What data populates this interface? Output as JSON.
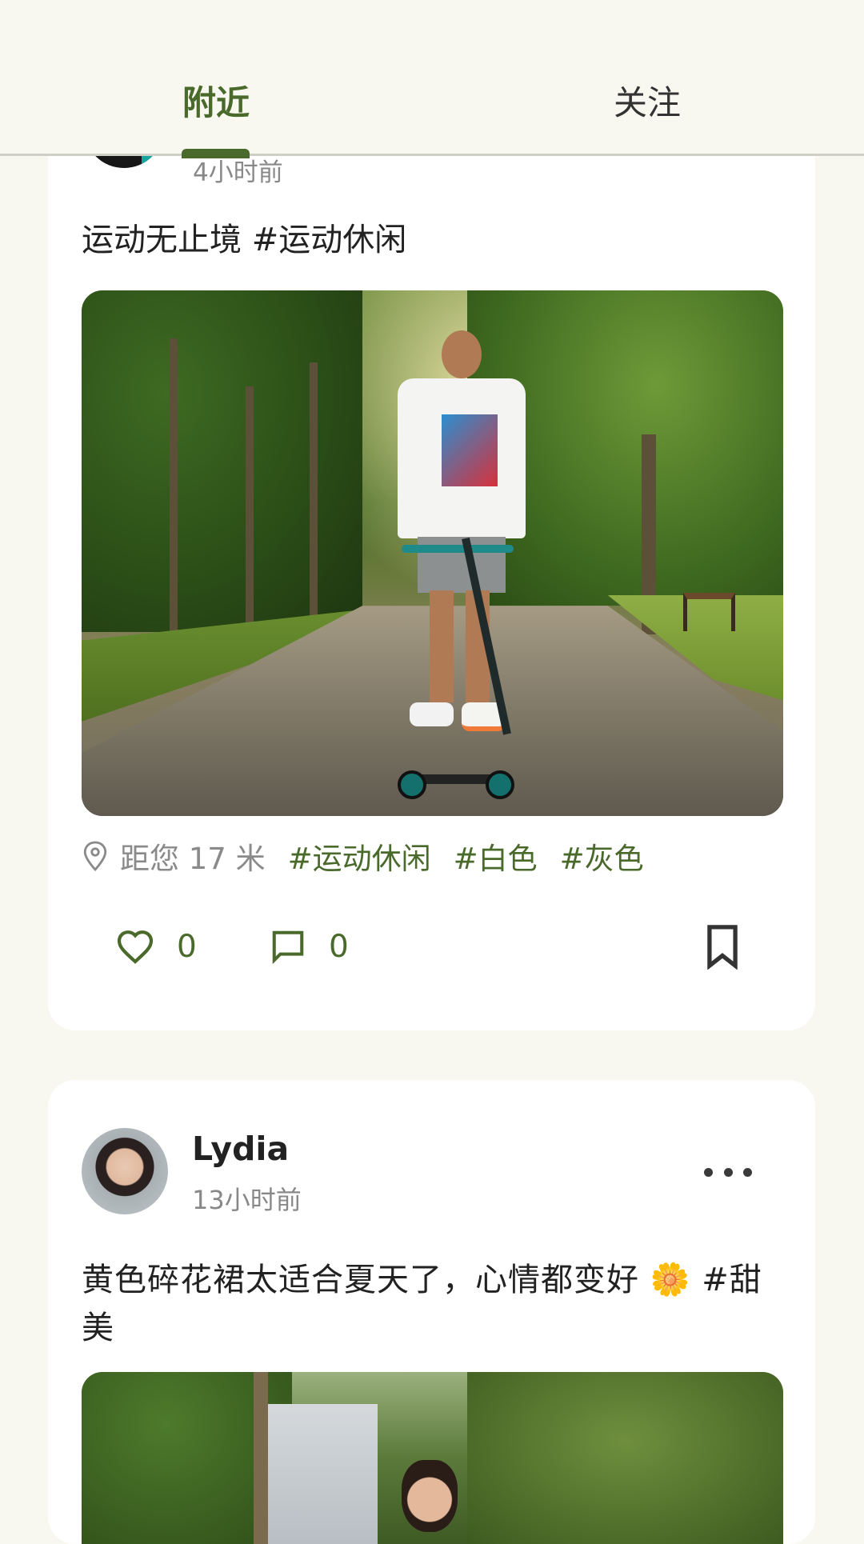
{
  "tabs": [
    {
      "label": "附近",
      "active": true
    },
    {
      "label": "关注",
      "active": false
    }
  ],
  "colors": {
    "accent": "#4a6a2c",
    "background": "#f8f8f1",
    "card": "#ffffff"
  },
  "posts": [
    {
      "time": "4小时前",
      "text": "运动无止境 #运动休闲",
      "distance": "距您 17 米",
      "tags": [
        "#运动休闲",
        "#白色",
        "#灰色"
      ],
      "likes": "0",
      "comments": "0",
      "icons": [
        "location-icon",
        "heart-icon",
        "comment-icon",
        "bookmark-icon"
      ]
    },
    {
      "author": "Lydia",
      "time": "13小时前",
      "text": "黄色碎花裙太适合夏天了，心情都变好 🌼 #甜美",
      "icons": [
        "more-icon"
      ]
    }
  ]
}
